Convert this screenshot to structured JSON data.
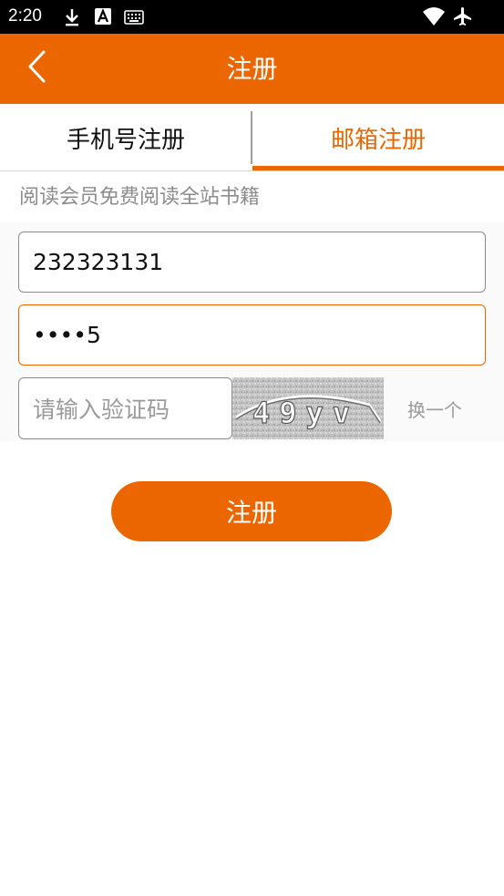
{
  "status_bar": {
    "time": "2:20",
    "icons": [
      "download-icon",
      "text-a-icon",
      "keyboard-icon",
      "wifi-icon",
      "airplane-mode-icon"
    ]
  },
  "app_bar": {
    "title": "注册",
    "back_icon": "chevron-left-icon"
  },
  "tabs": [
    {
      "label": "手机号注册",
      "selected": false
    },
    {
      "label": "邮箱注册",
      "selected": true
    }
  ],
  "hint": "阅读会员免费阅读全站书籍",
  "form": {
    "account_value": "232323131",
    "password_value": "••••5",
    "captcha_placeholder": "请输入验证码",
    "captcha_text": "49yv",
    "refresh_label": "换一个"
  },
  "submit_label": "注册",
  "colors": {
    "accent": "#ec6600",
    "status_bar": "#000000",
    "hint_text": "#8c8c8c"
  }
}
